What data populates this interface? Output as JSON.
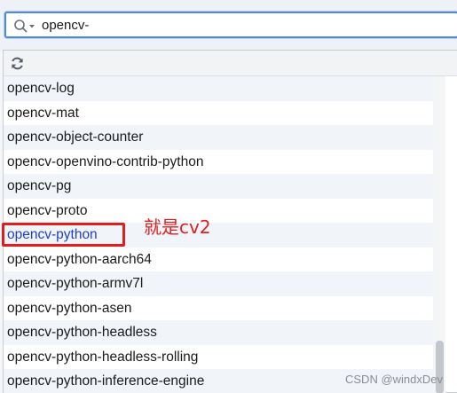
{
  "search": {
    "value": "opencv-",
    "icon": "search-icon"
  },
  "toolbar": {
    "refresh_icon": "refresh-icon"
  },
  "packages": [
    {
      "name": "opencv-log"
    },
    {
      "name": "opencv-mat"
    },
    {
      "name": "opencv-object-counter"
    },
    {
      "name": "opencv-openvino-contrib-python"
    },
    {
      "name": "opencv-pg"
    },
    {
      "name": "opencv-proto"
    },
    {
      "name": "opencv-python"
    },
    {
      "name": "opencv-python-aarch64"
    },
    {
      "name": "opencv-python-armv7l"
    },
    {
      "name": "opencv-python-asen"
    },
    {
      "name": "opencv-python-headless"
    },
    {
      "name": "opencv-python-headless-rolling"
    },
    {
      "name": "opencv-python-inference-engine"
    }
  ],
  "selected_package": "opencv-python",
  "annotation": {
    "text": "就是cv2",
    "color": "#e01e1e"
  },
  "watermark": "CSDN @windxDev",
  "colors": {
    "selected_text": "#1f3fd1",
    "highlight_border": "#e01e1e",
    "search_border": "#4e8ad6",
    "alt_row": "#f1f5fa"
  }
}
